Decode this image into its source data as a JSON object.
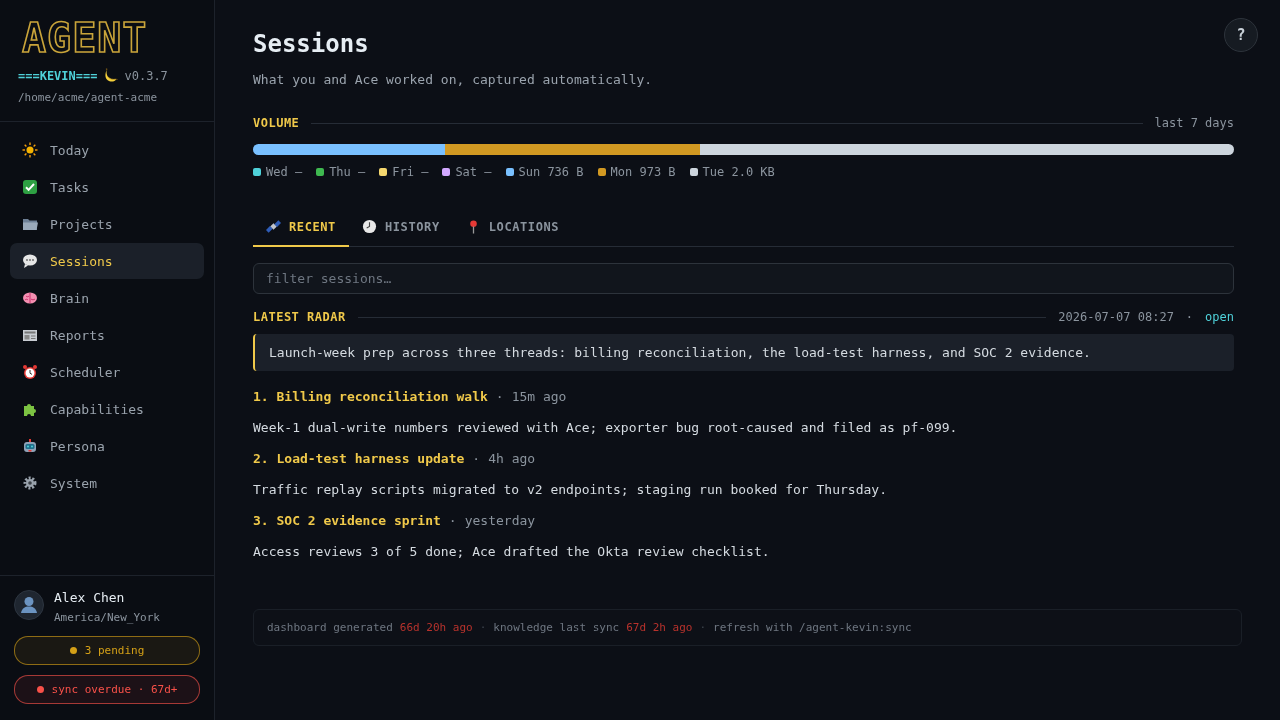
{
  "brand": {
    "logo": "AGENT",
    "name": "===KEVIN===",
    "version": "v0.3.7",
    "path": "/home/acme/agent-acme"
  },
  "nav": [
    {
      "label": "Today",
      "selected": false
    },
    {
      "label": "Tasks",
      "selected": false
    },
    {
      "label": "Projects",
      "selected": false
    },
    {
      "label": "Sessions",
      "selected": true
    },
    {
      "label": "Brain",
      "selected": false
    },
    {
      "label": "Reports",
      "selected": false
    },
    {
      "label": "Scheduler",
      "selected": false
    },
    {
      "label": "Capabilities",
      "selected": false
    },
    {
      "label": "Persona",
      "selected": false
    },
    {
      "label": "System",
      "selected": false
    }
  ],
  "user": {
    "name": "Alex Chen",
    "timezone": "America/New_York"
  },
  "badges": [
    {
      "text": "3 pending",
      "color": "#d4a017"
    },
    {
      "text": "sync overdue · 67d+",
      "color": "#f85149"
    }
  ],
  "help": "?",
  "separator": "·",
  "page": {
    "title": "Sessions",
    "subtitle": "What you and Ace worked on, captured automatically."
  },
  "volume": {
    "heading": "VOLUME",
    "range": "last 7 days",
    "bar": [
      {
        "color": "#79c0ff",
        "level": 0.196
      },
      {
        "color": "#d29922",
        "level": 0.26
      },
      {
        "color": "#cdd5dd",
        "level": 0.544
      }
    ],
    "legend": [
      {
        "day": "Wed",
        "amount": "—",
        "color": "#4fd1d9"
      },
      {
        "day": "Thu",
        "amount": "—",
        "color": "#3fb950"
      },
      {
        "day": "Fri",
        "amount": "—",
        "color": "#f5d76e"
      },
      {
        "day": "Sat",
        "amount": "—",
        "color": "#d2a8ff"
      },
      {
        "day": "Sun",
        "amount": "736 B",
        "color": "#79c0ff"
      },
      {
        "day": "Mon",
        "amount": "973 B",
        "color": "#d29922"
      },
      {
        "day": "Tue",
        "amount": "2.0 KB",
        "color": "#cdd5dd"
      }
    ]
  },
  "tabs": [
    {
      "label": "RECENT",
      "selected": true
    },
    {
      "label": "HISTORY",
      "selected": false
    },
    {
      "label": "LOCATIONS",
      "selected": false
    }
  ],
  "filter": {
    "placeholder": "filter sessions…"
  },
  "radar": {
    "heading": "LATEST RADAR",
    "timestamp": "2026-07-07 08:27",
    "link": "open",
    "summary": "Launch-week prep across three threads: billing reconciliation, the load-test harness, and SOC 2 evidence."
  },
  "sessions": [
    {
      "title": "1. Billing reconciliation walk",
      "age": "15m ago",
      "summary": "Week-1 dual-write numbers reviewed with Ace; exporter bug root-caused and filed as pf-099."
    },
    {
      "title": "2. Load-test harness update",
      "age": "4h ago",
      "summary": "Traffic replay scripts migrated to v2 endpoints; staging run booked for Thursday."
    },
    {
      "title": "3. SOC 2 evidence sprint",
      "age": "yesterday",
      "summary": "Access reviews 3 of 5 done; Ace drafted the Okta review checklist."
    }
  ],
  "footer": [
    {
      "label": "dashboard generated",
      "age": "66d 20h ago"
    },
    {
      "label": "knowledge last sync",
      "age": "67d 2h ago"
    },
    {
      "label": "refresh with /agent-kevin:sync"
    }
  ]
}
